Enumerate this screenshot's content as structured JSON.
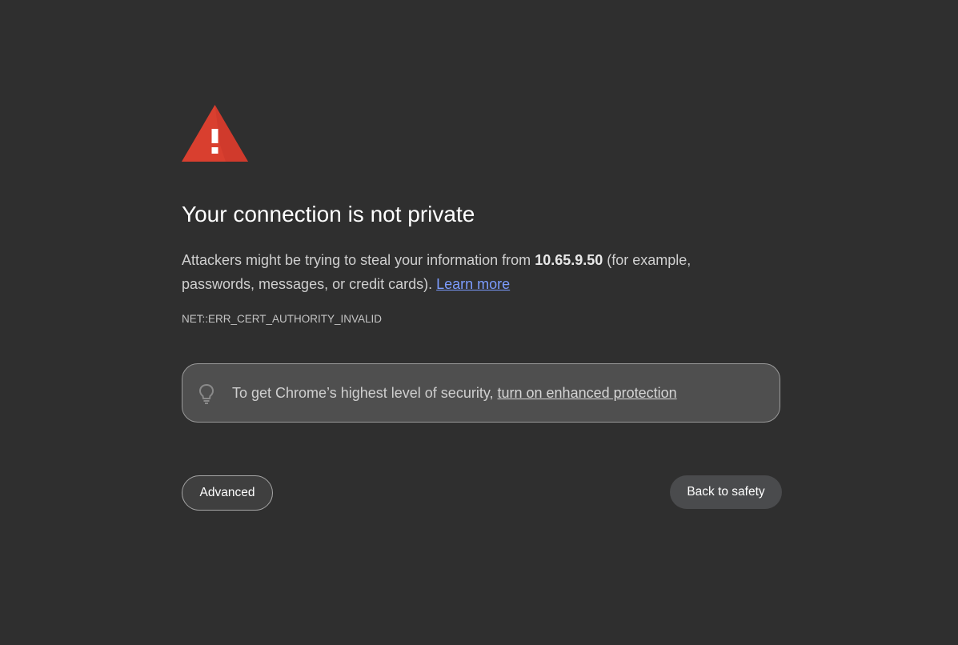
{
  "icons": {
    "warning": "warning-triangle-icon",
    "lightbulb": "lightbulb-icon"
  },
  "colors": {
    "background": "#2f2f2f",
    "warning_red": "#d93f2f",
    "link_blue": "#7c9cff"
  },
  "interstitial": {
    "title": "Your connection is not private",
    "description_before": "Attackers might be trying to steal your information from ",
    "host": "10.65.9.50",
    "description_after": " (for example, passwords, messages, or credit cards). ",
    "learn_more": "Learn more",
    "error_code": "NET::ERR_CERT_AUTHORITY_INVALID"
  },
  "enhanced_protection": {
    "text": "To get Chrome’s highest level of security, ",
    "link": "turn on enhanced protection"
  },
  "buttons": {
    "advanced": "Advanced",
    "back_to_safety": "Back to safety"
  }
}
